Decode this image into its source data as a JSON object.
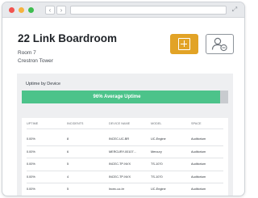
{
  "window": {
    "back_glyph": "‹",
    "forward_glyph": "›",
    "expand_glyph": "⤢",
    "icons": [
      "chevron-left-icon",
      "chevron-right-icon",
      "expand-icon"
    ]
  },
  "header": {
    "title": "22 Link Boardroom",
    "room": "Room 7",
    "building": "Crestron Tower"
  },
  "actions": {
    "add_icon": "add-device-icon",
    "user_icon": "remove-user-icon",
    "add_color": "#e2a326"
  },
  "uptime": {
    "label": "Uptime by Device",
    "average_percent": 96,
    "text": "96% Average Uptime",
    "fill_color": "#4cc38a"
  },
  "table": {
    "headers": [
      "UPTIME",
      "INCIDENTS",
      "DEVICE NAME",
      "MODEL",
      "SPACE"
    ],
    "rows": [
      [
        "0.00%",
        "8",
        "INCEC-UC-BR",
        "UC-Engine",
        "Auditorium"
      ],
      [
        "0.00%",
        "6",
        "MERCURY-00107...",
        "Mercury",
        "Auditorium"
      ],
      [
        "0.00%",
        "5",
        "INCEC-TP-NVX",
        "TS-1070",
        "Auditorium"
      ],
      [
        "0.00%",
        "4",
        "INCEC-TP-NVX",
        "TS-1070",
        "Auditorium"
      ],
      [
        "0.00%",
        "5",
        "Incec-uc-br",
        "UC-Engine",
        "Auditorium"
      ]
    ]
  }
}
